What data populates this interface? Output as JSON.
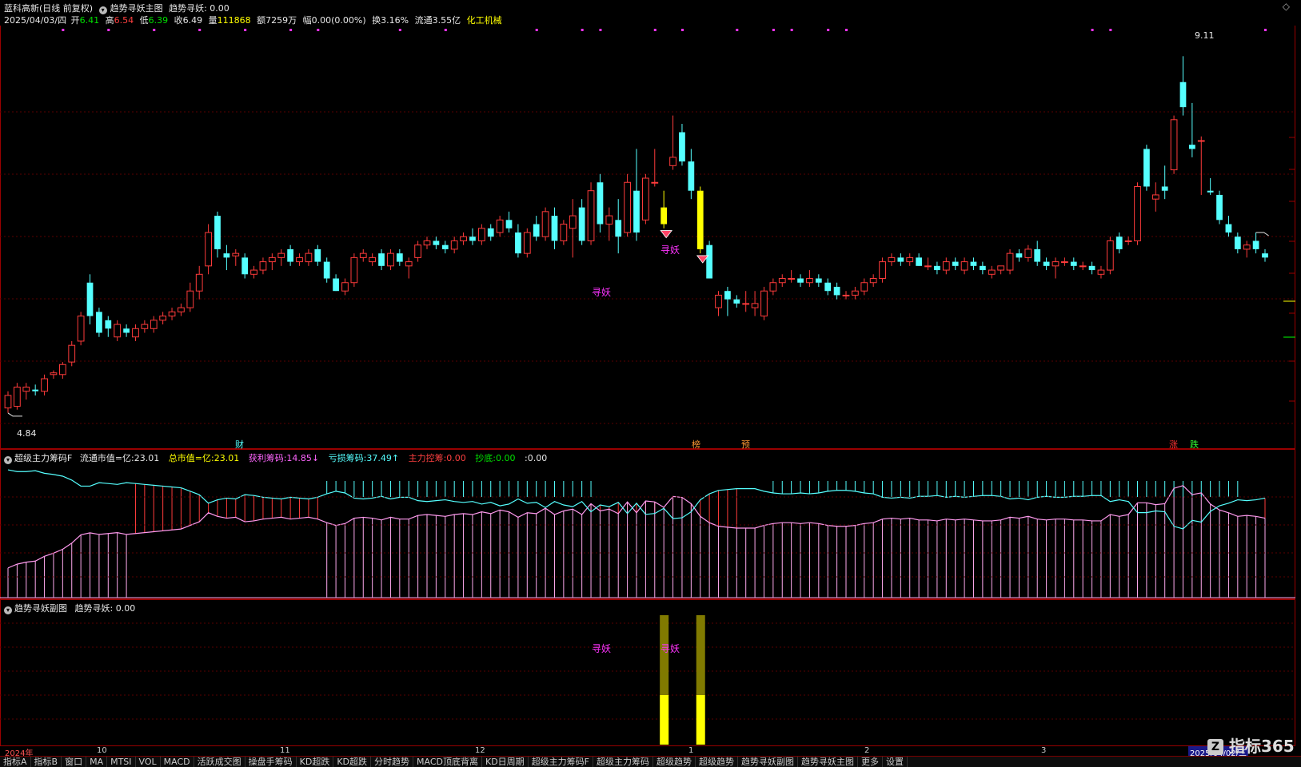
{
  "header": {
    "stock_name": "蓝科高新(日线 前复权)",
    "indicator_name": "趋势寻妖主图",
    "indicator_value": "趋势寻妖: 0.00",
    "date": "2025/04/03/四",
    "open_label": "开",
    "open": "6.41",
    "high_label": "高",
    "high": "6.54",
    "low_label": "低",
    "low": "6.39",
    "close_label": "收",
    "close": "6.49",
    "vol_label": "量",
    "volume": "111868",
    "amount_label": "额",
    "amount": "7259万",
    "change_label": "幅",
    "change": "0.00(0.00%)",
    "turnover_label": "换",
    "turnover": "3.16%",
    "float_label": "流通",
    "float_cap": "3.55亿",
    "sector": "化工机械"
  },
  "main_chart": {
    "price_high_label": "9.11",
    "price_low_label": "4.84",
    "signal_text": "寻妖",
    "markers": [
      {
        "text": "财",
        "color": "#55ffff"
      },
      {
        "text": "榜",
        "color": "#ff9933"
      },
      {
        "text": "预",
        "color": "#ff9933"
      },
      {
        "text": "涨",
        "color": "#ff3333"
      },
      {
        "text": "跌",
        "color": "#33ff33"
      }
    ]
  },
  "chip_panel": {
    "title": "超级主力筹码F",
    "items": [
      {
        "label": "流通市值=亿:",
        "value": "23.01",
        "color": "#e8e8e8"
      },
      {
        "label": "总市值=亿:",
        "value": "23.01",
        "color": "#ffff00"
      },
      {
        "label": "获利筹码:",
        "value": "14.85↓",
        "color": "#ff66ff"
      },
      {
        "label": "亏损筹码:",
        "value": "37.49↑",
        "color": "#55ffff"
      },
      {
        "label": "主力控筹:",
        "value": "0.00",
        "color": "#ff3333"
      },
      {
        "label": "抄底:",
        "value": "0.00",
        "color": "#33ff33"
      },
      {
        "label": ":",
        "value": "0.00",
        "color": "#e8e8e8"
      }
    ]
  },
  "sub_panel": {
    "title": "趋势寻妖副图",
    "value": "趋势寻妖: 0.00",
    "signal_text": "寻妖"
  },
  "x_axis": [
    "2024年",
    "10",
    "11",
    "12",
    "1",
    "2",
    "3",
    "2025/04/02/三"
  ],
  "tabs": [
    "指标A",
    "指标B",
    "窗口",
    "MA",
    "MTSI",
    "VOL",
    "MACD",
    "活跃成交图",
    "操盘手筹码",
    "KD超跌",
    "KD超跌",
    "分时趋势",
    "MACD顶底背离",
    "KD日周期",
    "超级主力筹码F",
    "超级主力筹码",
    "超级趋势",
    "超级趋势",
    "趋势寻妖副图",
    "趋势寻妖主图",
    "更多",
    "设置"
  ],
  "brand": "指标365",
  "chart_data": {
    "type": "candlestick",
    "price_ylim": [
      4.6,
      9.4
    ],
    "candles": [
      {
        "o": 4.9,
        "h": 5.1,
        "l": 4.84,
        "c": 5.05
      },
      {
        "o": 4.92,
        "h": 5.2,
        "l": 4.88,
        "c": 5.15
      },
      {
        "o": 5.1,
        "h": 5.2,
        "l": 5.0,
        "c": 5.15
      },
      {
        "o": 5.12,
        "h": 5.18,
        "l": 5.05,
        "c": 5.1
      },
      {
        "o": 5.1,
        "h": 5.3,
        "l": 5.05,
        "c": 5.25
      },
      {
        "o": 5.3,
        "h": 5.35,
        "l": 5.25,
        "c": 5.32
      },
      {
        "o": 5.3,
        "h": 5.45,
        "l": 5.25,
        "c": 5.42
      },
      {
        "o": 5.45,
        "h": 5.7,
        "l": 5.4,
        "c": 5.65
      },
      {
        "o": 5.7,
        "h": 6.05,
        "l": 5.65,
        "c": 6.0
      },
      {
        "o": 6.4,
        "h": 6.5,
        "l": 5.9,
        "c": 6.0
      },
      {
        "o": 6.05,
        "h": 6.1,
        "l": 5.75,
        "c": 5.8
      },
      {
        "o": 5.95,
        "h": 6.0,
        "l": 5.75,
        "c": 5.85
      },
      {
        "o": 5.75,
        "h": 5.95,
        "l": 5.7,
        "c": 5.9
      },
      {
        "o": 5.85,
        "h": 5.9,
        "l": 5.75,
        "c": 5.8
      },
      {
        "o": 5.75,
        "h": 5.9,
        "l": 5.7,
        "c": 5.85
      },
      {
        "o": 5.85,
        "h": 5.95,
        "l": 5.8,
        "c": 5.9
      },
      {
        "o": 5.85,
        "h": 6.0,
        "l": 5.8,
        "c": 5.95
      },
      {
        "o": 5.95,
        "h": 6.05,
        "l": 5.9,
        "c": 6.0
      },
      {
        "o": 6.0,
        "h": 6.1,
        "l": 5.95,
        "c": 6.05
      },
      {
        "o": 6.05,
        "h": 6.15,
        "l": 6.0,
        "c": 6.1
      },
      {
        "o": 6.1,
        "h": 6.4,
        "l": 6.05,
        "c": 6.3
      },
      {
        "o": 6.3,
        "h": 6.6,
        "l": 6.2,
        "c": 6.5
      },
      {
        "o": 6.6,
        "h": 7.1,
        "l": 6.5,
        "c": 7.0
      },
      {
        "o": 7.2,
        "h": 7.25,
        "l": 6.7,
        "c": 6.8
      },
      {
        "o": 6.75,
        "h": 6.85,
        "l": 6.55,
        "c": 6.7
      },
      {
        "o": 6.72,
        "h": 6.8,
        "l": 6.6,
        "c": 6.75
      },
      {
        "o": 6.7,
        "h": 6.75,
        "l": 6.45,
        "c": 6.5
      },
      {
        "o": 6.5,
        "h": 6.6,
        "l": 6.45,
        "c": 6.55
      },
      {
        "o": 6.55,
        "h": 6.7,
        "l": 6.5,
        "c": 6.65
      },
      {
        "o": 6.65,
        "h": 6.75,
        "l": 6.55,
        "c": 6.7
      },
      {
        "o": 6.7,
        "h": 6.8,
        "l": 6.6,
        "c": 6.75
      },
      {
        "o": 6.8,
        "h": 6.85,
        "l": 6.6,
        "c": 6.65
      },
      {
        "o": 6.65,
        "h": 6.75,
        "l": 6.6,
        "c": 6.7
      },
      {
        "o": 6.65,
        "h": 6.8,
        "l": 6.6,
        "c": 6.75
      },
      {
        "o": 6.8,
        "h": 6.85,
        "l": 6.6,
        "c": 6.65
      },
      {
        "o": 6.65,
        "h": 6.7,
        "l": 6.4,
        "c": 6.45
      },
      {
        "o": 6.45,
        "h": 6.5,
        "l": 6.3,
        "c": 6.3
      },
      {
        "o": 6.3,
        "h": 6.45,
        "l": 6.25,
        "c": 6.4
      },
      {
        "o": 6.4,
        "h": 6.75,
        "l": 6.35,
        "c": 6.7
      },
      {
        "o": 6.7,
        "h": 6.8,
        "l": 6.65,
        "c": 6.75
      },
      {
        "o": 6.65,
        "h": 6.75,
        "l": 6.6,
        "c": 6.7
      },
      {
        "o": 6.75,
        "h": 6.8,
        "l": 6.55,
        "c": 6.6
      },
      {
        "o": 6.6,
        "h": 6.8,
        "l": 6.55,
        "c": 6.75
      },
      {
        "o": 6.75,
        "h": 6.8,
        "l": 6.6,
        "c": 6.65
      },
      {
        "o": 6.6,
        "h": 6.7,
        "l": 6.45,
        "c": 6.65
      },
      {
        "o": 6.7,
        "h": 6.9,
        "l": 6.65,
        "c": 6.85
      },
      {
        "o": 6.85,
        "h": 6.95,
        "l": 6.8,
        "c": 6.9
      },
      {
        "o": 6.9,
        "h": 6.95,
        "l": 6.8,
        "c": 6.85
      },
      {
        "o": 6.85,
        "h": 6.9,
        "l": 6.75,
        "c": 6.8
      },
      {
        "o": 6.8,
        "h": 6.95,
        "l": 6.75,
        "c": 6.9
      },
      {
        "o": 6.9,
        "h": 7.0,
        "l": 6.85,
        "c": 6.95
      },
      {
        "o": 6.95,
        "h": 7.05,
        "l": 6.85,
        "c": 6.9
      },
      {
        "o": 6.9,
        "h": 7.1,
        "l": 6.85,
        "c": 7.05
      },
      {
        "o": 7.05,
        "h": 7.1,
        "l": 6.9,
        "c": 6.95
      },
      {
        "o": 7.0,
        "h": 7.2,
        "l": 6.95,
        "c": 7.15
      },
      {
        "o": 7.15,
        "h": 7.25,
        "l": 7.0,
        "c": 7.05
      },
      {
        "o": 7.0,
        "h": 7.1,
        "l": 6.7,
        "c": 6.75
      },
      {
        "o": 6.75,
        "h": 7.05,
        "l": 6.7,
        "c": 7.0
      },
      {
        "o": 7.1,
        "h": 7.2,
        "l": 6.9,
        "c": 6.95
      },
      {
        "o": 6.95,
        "h": 7.3,
        "l": 6.9,
        "c": 7.25
      },
      {
        "o": 7.2,
        "h": 7.3,
        "l": 6.8,
        "c": 6.9
      },
      {
        "o": 6.9,
        "h": 7.15,
        "l": 6.85,
        "c": 7.1
      },
      {
        "o": 7.05,
        "h": 7.4,
        "l": 6.7,
        "c": 7.2
      },
      {
        "o": 7.3,
        "h": 7.4,
        "l": 6.85,
        "c": 6.9
      },
      {
        "o": 6.9,
        "h": 7.6,
        "l": 6.85,
        "c": 7.5
      },
      {
        "o": 7.6,
        "h": 7.7,
        "l": 7.0,
        "c": 7.1
      },
      {
        "o": 7.1,
        "h": 7.3,
        "l": 6.9,
        "c": 7.2
      },
      {
        "o": 7.15,
        "h": 7.4,
        "l": 6.75,
        "c": 6.95
      },
      {
        "o": 7.0,
        "h": 7.7,
        "l": 6.95,
        "c": 7.6
      },
      {
        "o": 7.5,
        "h": 8.0,
        "l": 6.9,
        "c": 7.0
      },
      {
        "o": 7.15,
        "h": 7.7,
        "l": 7.1,
        "c": 7.65
      },
      {
        "o": 7.6,
        "h": 8.0,
        "l": 7.55,
        "c": 7.6
      },
      {
        "o": 7.1,
        "h": 7.5,
        "l": 7.05,
        "c": 7.3
      },
      {
        "o": 7.8,
        "h": 8.4,
        "l": 7.75,
        "c": 7.9
      },
      {
        "o": 8.2,
        "h": 8.3,
        "l": 7.8,
        "c": 7.85
      },
      {
        "o": 7.85,
        "h": 8.0,
        "l": 7.4,
        "c": 7.5
      },
      {
        "o": 7.5,
        "h": 7.55,
        "l": 6.75,
        "c": 6.8
      },
      {
        "o": 6.85,
        "h": 6.9,
        "l": 6.45,
        "c": 6.45
      },
      {
        "o": 6.1,
        "h": 6.3,
        "l": 6.0,
        "c": 6.25
      },
      {
        "o": 6.3,
        "h": 6.35,
        "l": 6.0,
        "c": 6.2
      },
      {
        "o": 6.2,
        "h": 6.25,
        "l": 6.1,
        "c": 6.15
      },
      {
        "o": 6.15,
        "h": 6.3,
        "l": 6.05,
        "c": 6.15
      },
      {
        "o": 6.1,
        "h": 6.3,
        "l": 6.0,
        "c": 6.15
      },
      {
        "o": 6.0,
        "h": 6.35,
        "l": 5.95,
        "c": 6.3
      },
      {
        "o": 6.3,
        "h": 6.45,
        "l": 6.25,
        "c": 6.4
      },
      {
        "o": 6.4,
        "h": 6.5,
        "l": 6.35,
        "c": 6.45
      },
      {
        "o": 6.45,
        "h": 6.55,
        "l": 6.4,
        "c": 6.45
      },
      {
        "o": 6.45,
        "h": 6.5,
        "l": 6.35,
        "c": 6.4
      },
      {
        "o": 6.4,
        "h": 6.55,
        "l": 6.35,
        "c": 6.45
      },
      {
        "o": 6.45,
        "h": 6.5,
        "l": 6.35,
        "c": 6.4
      },
      {
        "o": 6.4,
        "h": 6.45,
        "l": 6.25,
        "c": 6.3
      },
      {
        "o": 6.35,
        "h": 6.4,
        "l": 6.2,
        "c": 6.25
      },
      {
        "o": 6.25,
        "h": 6.3,
        "l": 6.2,
        "c": 6.25
      },
      {
        "o": 6.25,
        "h": 6.35,
        "l": 6.2,
        "c": 6.3
      },
      {
        "o": 6.3,
        "h": 6.45,
        "l": 6.25,
        "c": 6.4
      },
      {
        "o": 6.4,
        "h": 6.5,
        "l": 6.35,
        "c": 6.45
      },
      {
        "o": 6.45,
        "h": 6.7,
        "l": 6.4,
        "c": 6.65
      },
      {
        "o": 6.65,
        "h": 6.75,
        "l": 6.6,
        "c": 6.7
      },
      {
        "o": 6.7,
        "h": 6.75,
        "l": 6.6,
        "c": 6.65
      },
      {
        "o": 6.65,
        "h": 6.75,
        "l": 6.6,
        "c": 6.7
      },
      {
        "o": 6.7,
        "h": 6.75,
        "l": 6.6,
        "c": 6.6
      },
      {
        "o": 6.6,
        "h": 6.7,
        "l": 6.55,
        "c": 6.6
      },
      {
        "o": 6.6,
        "h": 6.65,
        "l": 6.5,
        "c": 6.55
      },
      {
        "o": 6.55,
        "h": 6.7,
        "l": 6.5,
        "c": 6.65
      },
      {
        "o": 6.65,
        "h": 6.7,
        "l": 6.55,
        "c": 6.6
      },
      {
        "o": 6.55,
        "h": 6.7,
        "l": 6.5,
        "c": 6.65
      },
      {
        "o": 6.65,
        "h": 6.7,
        "l": 6.55,
        "c": 6.6
      },
      {
        "o": 6.6,
        "h": 6.65,
        "l": 6.5,
        "c": 6.55
      },
      {
        "o": 6.5,
        "h": 6.6,
        "l": 6.45,
        "c": 6.55
      },
      {
        "o": 6.55,
        "h": 6.6,
        "l": 6.5,
        "c": 6.6
      },
      {
        "o": 6.55,
        "h": 6.8,
        "l": 6.5,
        "c": 6.75
      },
      {
        "o": 6.75,
        "h": 6.8,
        "l": 6.65,
        "c": 6.7
      },
      {
        "o": 6.7,
        "h": 6.85,
        "l": 6.65,
        "c": 6.8
      },
      {
        "o": 6.8,
        "h": 6.9,
        "l": 6.6,
        "c": 6.65
      },
      {
        "o": 6.65,
        "h": 6.7,
        "l": 6.55,
        "c": 6.6
      },
      {
        "o": 6.6,
        "h": 6.7,
        "l": 6.45,
        "c": 6.65
      },
      {
        "o": 6.65,
        "h": 6.7,
        "l": 6.6,
        "c": 6.65
      },
      {
        "o": 6.65,
        "h": 6.7,
        "l": 6.55,
        "c": 6.6
      },
      {
        "o": 6.6,
        "h": 6.65,
        "l": 6.55,
        "c": 6.6
      },
      {
        "o": 6.6,
        "h": 6.65,
        "l": 6.5,
        "c": 6.55
      },
      {
        "o": 6.5,
        "h": 6.6,
        "l": 6.45,
        "c": 6.55
      },
      {
        "o": 6.55,
        "h": 6.95,
        "l": 6.5,
        "c": 6.9
      },
      {
        "o": 6.95,
        "h": 7.0,
        "l": 6.75,
        "c": 6.8
      },
      {
        "o": 6.9,
        "h": 6.95,
        "l": 6.85,
        "c": 6.9
      },
      {
        "o": 6.9,
        "h": 7.6,
        "l": 6.85,
        "c": 7.55
      },
      {
        "o": 8.0,
        "h": 8.05,
        "l": 7.5,
        "c": 7.55
      },
      {
        "o": 7.4,
        "h": 7.6,
        "l": 7.25,
        "c": 7.45
      },
      {
        "o": 7.55,
        "h": 7.8,
        "l": 7.4,
        "c": 7.5
      },
      {
        "o": 7.75,
        "h": 8.4,
        "l": 7.7,
        "c": 8.35
      },
      {
        "o": 8.8,
        "h": 9.11,
        "l": 8.4,
        "c": 8.5
      },
      {
        "o": 8.05,
        "h": 8.55,
        "l": 7.9,
        "c": 8.0
      },
      {
        "o": 8.1,
        "h": 8.15,
        "l": 7.45,
        "c": 8.1
      },
      {
        "o": 7.5,
        "h": 7.65,
        "l": 7.45,
        "c": 7.48
      },
      {
        "o": 7.45,
        "h": 7.5,
        "l": 7.1,
        "c": 7.15
      },
      {
        "o": 7.1,
        "h": 7.2,
        "l": 6.95,
        "c": 7.0
      },
      {
        "o": 6.95,
        "h": 7.0,
        "l": 6.75,
        "c": 6.8
      },
      {
        "o": 6.8,
        "h": 6.9,
        "l": 6.7,
        "c": 6.85
      },
      {
        "o": 6.9,
        "h": 7.0,
        "l": 6.75,
        "c": 6.8
      },
      {
        "o": 6.75,
        "h": 6.8,
        "l": 6.65,
        "c": 6.7
      }
    ],
    "signal_indices": [
      72,
      76
    ]
  }
}
